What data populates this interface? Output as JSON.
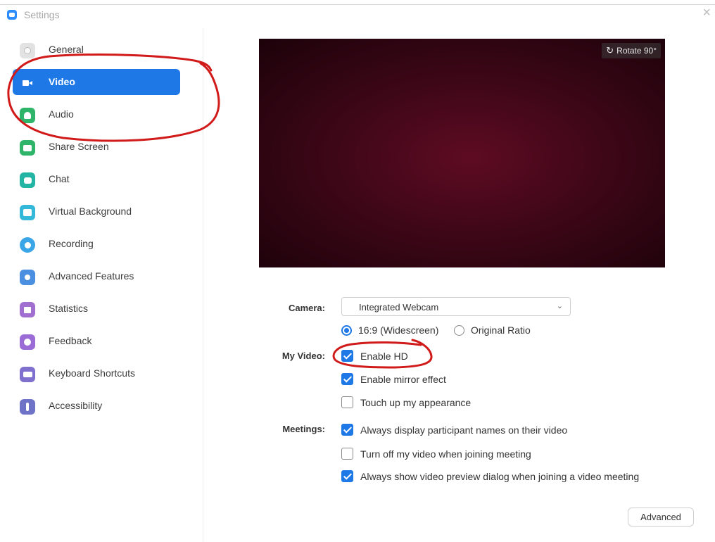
{
  "window": {
    "title": "Settings"
  },
  "sidebar": {
    "items": [
      {
        "label": "General",
        "icon": "gear-icon",
        "color": "#cfcfcf"
      },
      {
        "label": "Video",
        "icon": "video-camera-icon",
        "color": "#1e78e6",
        "active": true
      },
      {
        "label": "Audio",
        "icon": "headphones-icon",
        "color": "#2fb56a"
      },
      {
        "label": "Share Screen",
        "icon": "share-screen-icon",
        "color": "#2fb56a"
      },
      {
        "label": "Chat",
        "icon": "chat-bubble-icon",
        "color": "#22b5a4"
      },
      {
        "label": "Virtual Background",
        "icon": "person-frame-icon",
        "color": "#34b8d9"
      },
      {
        "label": "Recording",
        "icon": "record-icon",
        "color": "#3aa6e8"
      },
      {
        "label": "Advanced Features",
        "icon": "advanced-features-icon",
        "color": "#4a8fe0"
      },
      {
        "label": "Statistics",
        "icon": "bar-chart-icon",
        "color": "#a06fd0"
      },
      {
        "label": "Feedback",
        "icon": "smiley-icon",
        "color": "#9b6bd6"
      },
      {
        "label": "Keyboard Shortcuts",
        "icon": "keyboard-icon",
        "color": "#7f70cf"
      },
      {
        "label": "Accessibility",
        "icon": "accessibility-person-icon",
        "color": "#6e73c8"
      }
    ]
  },
  "preview": {
    "rotate_label": "Rotate 90°"
  },
  "camera": {
    "label": "Camera:",
    "selected": "Integrated Webcam"
  },
  "aspect": {
    "options": [
      {
        "label": "16:9 (Widescreen)",
        "selected": true
      },
      {
        "label": "Original Ratio",
        "selected": false
      }
    ]
  },
  "my_video": {
    "label": "My Video:",
    "options": [
      {
        "label": "Enable HD",
        "checked": true
      },
      {
        "label": "Enable mirror effect",
        "checked": true
      },
      {
        "label": "Touch up my appearance",
        "checked": false
      }
    ]
  },
  "meetings": {
    "label": "Meetings:",
    "options": [
      {
        "label": "Always display participant names on their video",
        "checked": true
      },
      {
        "label": "Turn off my video when joining meeting",
        "checked": false
      },
      {
        "label": "Always show video preview dialog when joining a video meeting",
        "checked": true
      }
    ]
  },
  "footer": {
    "advanced_label": "Advanced"
  },
  "colors": {
    "accent": "#1e78e6",
    "annotation": "#d11a1a"
  }
}
